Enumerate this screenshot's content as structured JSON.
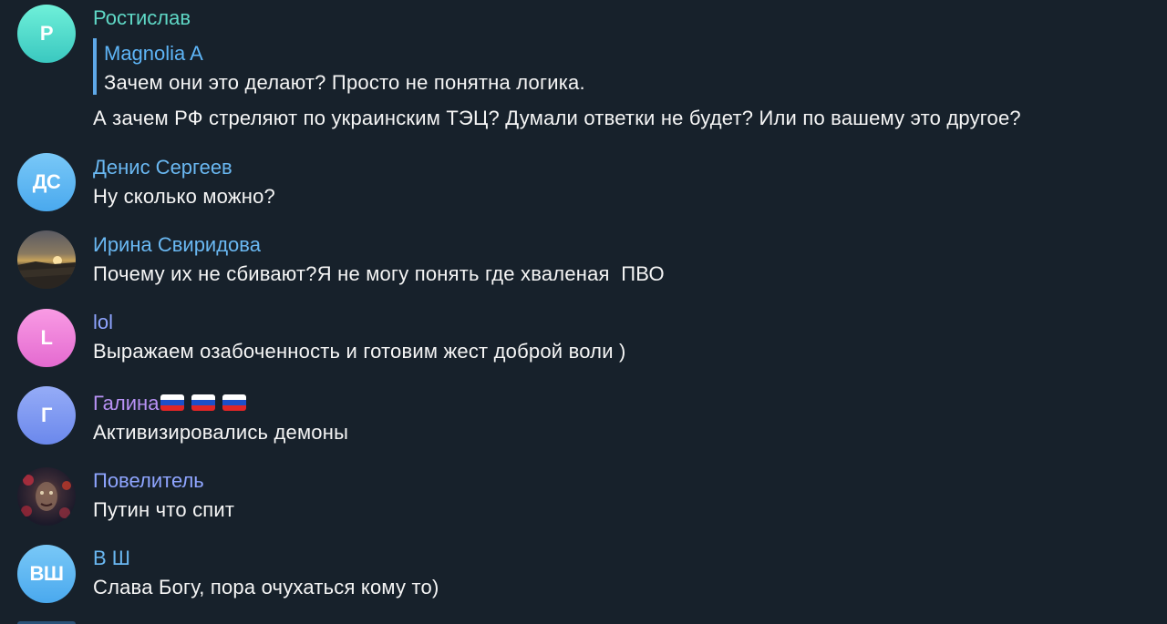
{
  "messages": [
    {
      "avatar_letter": "Р",
      "avatar_kind": "letter",
      "name": "Ростислав",
      "reply": {
        "name": "Magnolia A",
        "text": "Зачем они это делают? Просто не понятна логика."
      },
      "text": "А зачем РФ стреляют по украинским ТЭЦ? Думали ответки не будет? Или по вашему это другое?"
    },
    {
      "avatar_letter": "ДС",
      "avatar_kind": "letter",
      "name": "Денис Сергеев",
      "text": "Ну сколько можно?"
    },
    {
      "avatar_letter": "",
      "avatar_kind": "photo-sunset",
      "name": "Ирина Свиридова",
      "text": "Почему их не сбивают?Я не могу понять где хваленая  ПВО"
    },
    {
      "avatar_letter": "L",
      "avatar_kind": "letter",
      "name": "lol",
      "text": "Выражаем озабоченность и готовим жест доброй воли )"
    },
    {
      "avatar_letter": "Г",
      "avatar_kind": "letter",
      "name": "Галина",
      "text": "Активизировались демоны"
    },
    {
      "avatar_letter": "",
      "avatar_kind": "photo-art",
      "name": "Повелитель",
      "text": "Путин что спит"
    },
    {
      "avatar_letter": "ВШ",
      "avatar_kind": "letter",
      "name": "В Ш",
      "text": "Слава Богу, пора очухаться кому то)"
    }
  ],
  "colors": {
    "background": "#17212b",
    "name_green": "#5fd8c6",
    "name_blue": "#6ab8f2",
    "name_purple": "#b892f5",
    "name_violet": "#8fa5ff",
    "avatar_teal": "#4fd8c9",
    "avatar_blue": "#62b7f1",
    "avatar_pink": "#f07ad6",
    "avatar_indigo": "#7e9af3"
  },
  "icons": {
    "flag": "russian-flag-icon"
  }
}
